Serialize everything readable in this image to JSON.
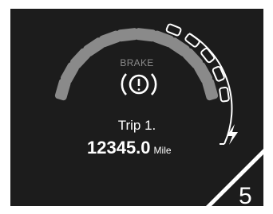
{
  "brake_warning": {
    "label": "BRAKE",
    "icon": "brake-warning-icon"
  },
  "trip": {
    "label": "Trip 1.",
    "distance": "12345.0",
    "unit": "Mile"
  },
  "gauge": {
    "total_segments": 12,
    "charge_segments": 5,
    "charge_icon": "lightning-bolt-icon"
  },
  "page": {
    "number": "5"
  },
  "colors": {
    "screen_background": "#1c1c1c",
    "segment": "#8a8a8a",
    "charge_outline": "#ffffff",
    "label_gray": "#8a8a8a",
    "text": "#ffffff"
  }
}
